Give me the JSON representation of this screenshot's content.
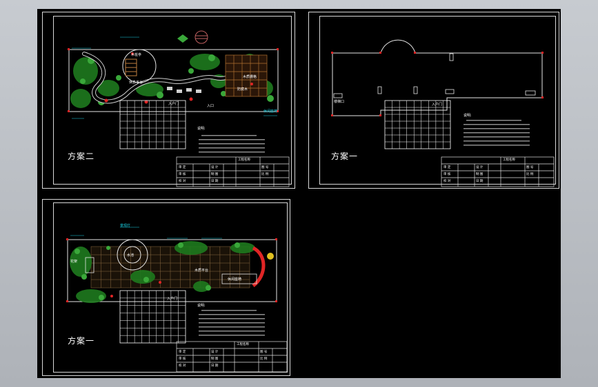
{
  "viewport": {
    "background": "#000000",
    "frame_color": "#d8d8d8",
    "accent_colors": {
      "green": "#3aa83a",
      "cyan": "#19d3e6",
      "red": "#e02525",
      "grid": "#ffffff",
      "wall": "#ffffff"
    }
  },
  "sheets": {
    "top_left": {
      "scheme_label": "方案二",
      "notes_title": "说明:",
      "map_labels": [
        {
          "text": "木桩亭",
          "color": "#ffffff"
        },
        {
          "text": "休息平台",
          "color": "#ffffff"
        },
        {
          "text": "木质栅格",
          "color": "#ffffff"
        },
        {
          "text": "防腐木",
          "color": "#ffffff"
        },
        {
          "text": "休闲座椅",
          "color": "#19d3e6"
        },
        {
          "text": "入户门",
          "color": "#ffffff"
        },
        {
          "text": "入口",
          "color": "#ffffff"
        }
      ],
      "title_block": {
        "rows": [
          [
            "审 定",
            "设 计",
            "工程名称"
          ],
          [
            "审 核",
            "制 图",
            "图 号"
          ],
          [
            "校 对",
            "日 期",
            "比 例"
          ]
        ]
      }
    },
    "top_right": {
      "scheme_label": "方案一",
      "notes_title": "说明:",
      "map_labels": [
        {
          "text": "入户门",
          "color": "#ffffff"
        },
        {
          "text": "楼梯口",
          "color": "#ffffff"
        }
      ],
      "title_block": {
        "rows": [
          [
            "审 定",
            "设 计",
            "工程名称"
          ],
          [
            "审 核",
            "制 图",
            "图 号"
          ],
          [
            "校 对",
            "日 期",
            "比 例"
          ]
        ]
      }
    },
    "bottom_left": {
      "scheme_label": "方案一",
      "notes_title": "说明:",
      "map_labels": [
        {
          "text": "花架",
          "color": "#ffffff"
        },
        {
          "text": "水池",
          "color": "#ffffff"
        },
        {
          "text": "入户门",
          "color": "#ffffff"
        },
        {
          "text": "木质平台",
          "color": "#ffffff"
        },
        {
          "text": "休闲座椅",
          "color": "#ffffff"
        },
        {
          "text": "景观灯",
          "color": "#19d3e6"
        }
      ],
      "title_block": {
        "rows": [
          [
            "审 定",
            "设 计",
            "工程名称"
          ],
          [
            "审 核",
            "制 图",
            "图 号"
          ],
          [
            "校 对",
            "日 期",
            "比 例"
          ]
        ]
      }
    }
  }
}
